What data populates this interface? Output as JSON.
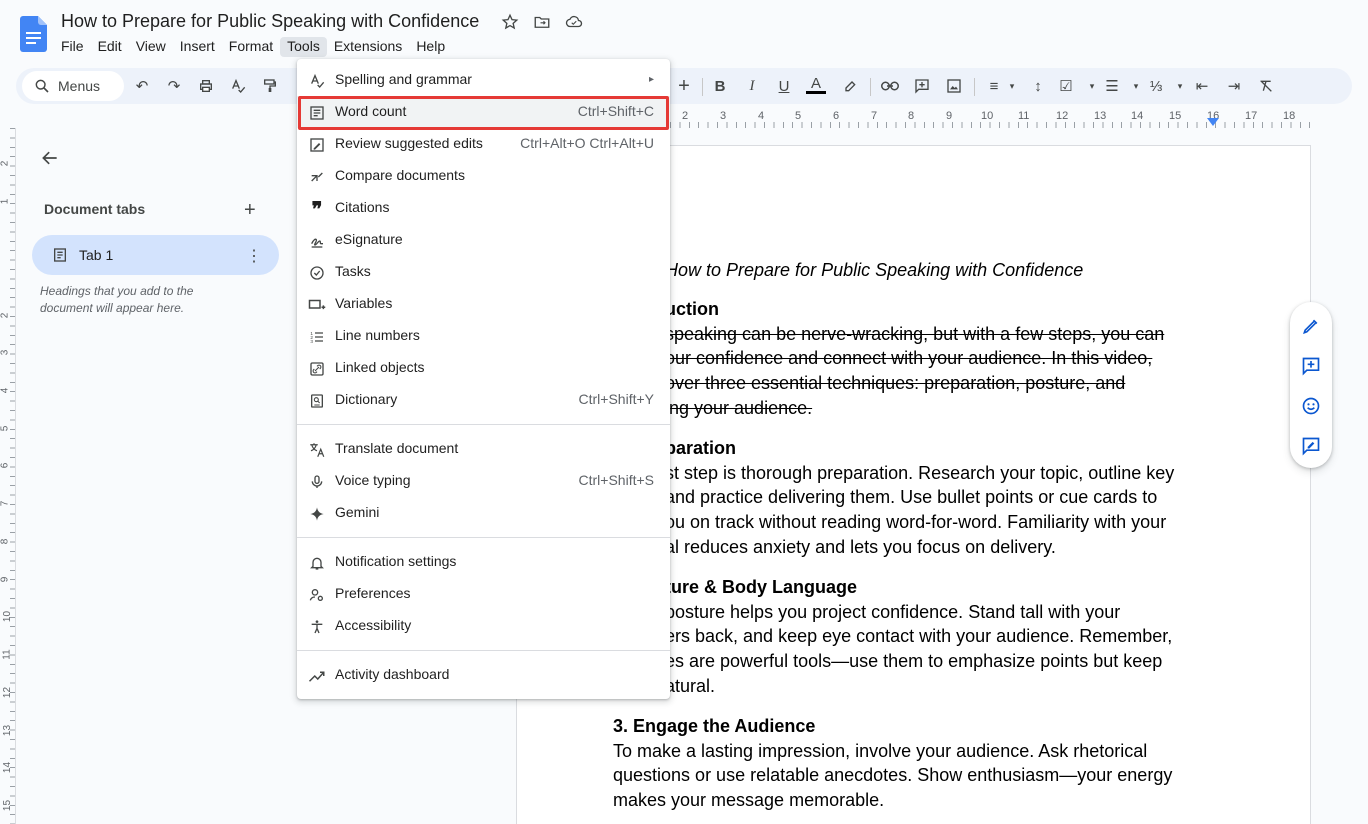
{
  "document": {
    "title": "How to Prepare for Public Speaking with Confidence"
  },
  "menubar": [
    "File",
    "Edit",
    "View",
    "Insert",
    "Format",
    "Tools",
    "Extensions",
    "Help"
  ],
  "toolbar": {
    "search_label": "Menus"
  },
  "ruler": {
    "numbers": [
      "2",
      "3",
      "4",
      "5",
      "6",
      "7",
      "8",
      "9",
      "10",
      "11",
      "12",
      "13",
      "14",
      "15",
      "16",
      "17",
      "18"
    ],
    "v_numbers": [
      "2",
      "1",
      "1",
      "2",
      "3",
      "4",
      "5",
      "6",
      "7",
      "8",
      "9",
      "10",
      "11",
      "12",
      "13",
      "14",
      "15"
    ]
  },
  "sidebar": {
    "title": "Document tabs",
    "tab_label": "Tab 1",
    "hint": "Headings that you add to the document will appear here."
  },
  "tools_menu": {
    "items": [
      {
        "label": "Spelling and grammar",
        "shortcut": "▸",
        "icon": "spellcheck-icon"
      },
      {
        "label": "Word count",
        "shortcut": "Ctrl+Shift+C",
        "icon": "word-count-icon"
      },
      {
        "label": "Review suggested edits",
        "shortcut": "Ctrl+Alt+O Ctrl+Alt+U",
        "icon": "review-edits-icon"
      },
      {
        "label": "Compare documents",
        "shortcut": "",
        "icon": "compare-icon"
      },
      {
        "label": "Citations",
        "shortcut": "",
        "icon": "citations-icon"
      },
      {
        "label": "eSignature",
        "shortcut": "",
        "icon": "signature-icon"
      },
      {
        "label": "Tasks",
        "shortcut": "",
        "icon": "tasks-icon"
      },
      {
        "label": "Variables",
        "shortcut": "",
        "icon": "variables-icon"
      },
      {
        "label": "Line numbers",
        "shortcut": "",
        "icon": "line-numbers-icon"
      },
      {
        "label": "Linked objects",
        "shortcut": "",
        "icon": "linked-objects-icon"
      },
      {
        "label": "Dictionary",
        "shortcut": "Ctrl+Shift+Y",
        "icon": "dictionary-icon"
      },
      {
        "label": "Translate document",
        "shortcut": "",
        "icon": "translate-icon"
      },
      {
        "label": "Voice typing",
        "shortcut": "Ctrl+Shift+S",
        "icon": "microphone-icon"
      },
      {
        "label": "Gemini",
        "shortcut": "",
        "icon": "gemini-icon"
      },
      {
        "label": "Notification settings",
        "shortcut": "",
        "icon": "bell-icon"
      },
      {
        "label": "Preferences",
        "shortcut": "",
        "icon": "preferences-icon"
      },
      {
        "label": "Accessibility",
        "shortcut": "",
        "icon": "accessibility-icon"
      },
      {
        "label": "Activity dashboard",
        "shortcut": "",
        "icon": "activity-icon"
      }
    ]
  },
  "content": {
    "doc_title": "How to Prepare for Public Speaking with Confidence",
    "intro_heading": "uction",
    "intro_lines": [
      "speaking can be nerve-wracking, but with a few steps, you can",
      "our confidence and connect with your audience. In this video,",
      "over three essential techniques: preparation, posture, and",
      "ing your audience."
    ],
    "prep_heading": "paration",
    "prep_lines": [
      "st step is thorough preparation. Research your topic, outline key",
      "and practice delivering them. Use bullet points or cue cards to",
      "ou on track without reading word-for-word. Familiarity with your",
      "al reduces anxiety and lets you focus on delivery."
    ],
    "posture_heading": "ture & Body Language",
    "posture_lines": [
      "posture helps you project confidence. Stand tall with your",
      "ers back, and keep eye contact with your audience. Remember,",
      "es are powerful tools—use them to emphasize points but keep",
      "atural."
    ],
    "engage_heading": "3. Engage the Audience",
    "engage_lines": [
      "To make a lasting impression, involve your audience. Ask rhetorical",
      "questions or use relatable anecdotes. Show enthusiasm—your energy",
      "makes your message memorable."
    ]
  },
  "colors": {
    "accent": "#0b57d0",
    "highlight_box": "#e53935",
    "background": "#f9fbfd"
  }
}
